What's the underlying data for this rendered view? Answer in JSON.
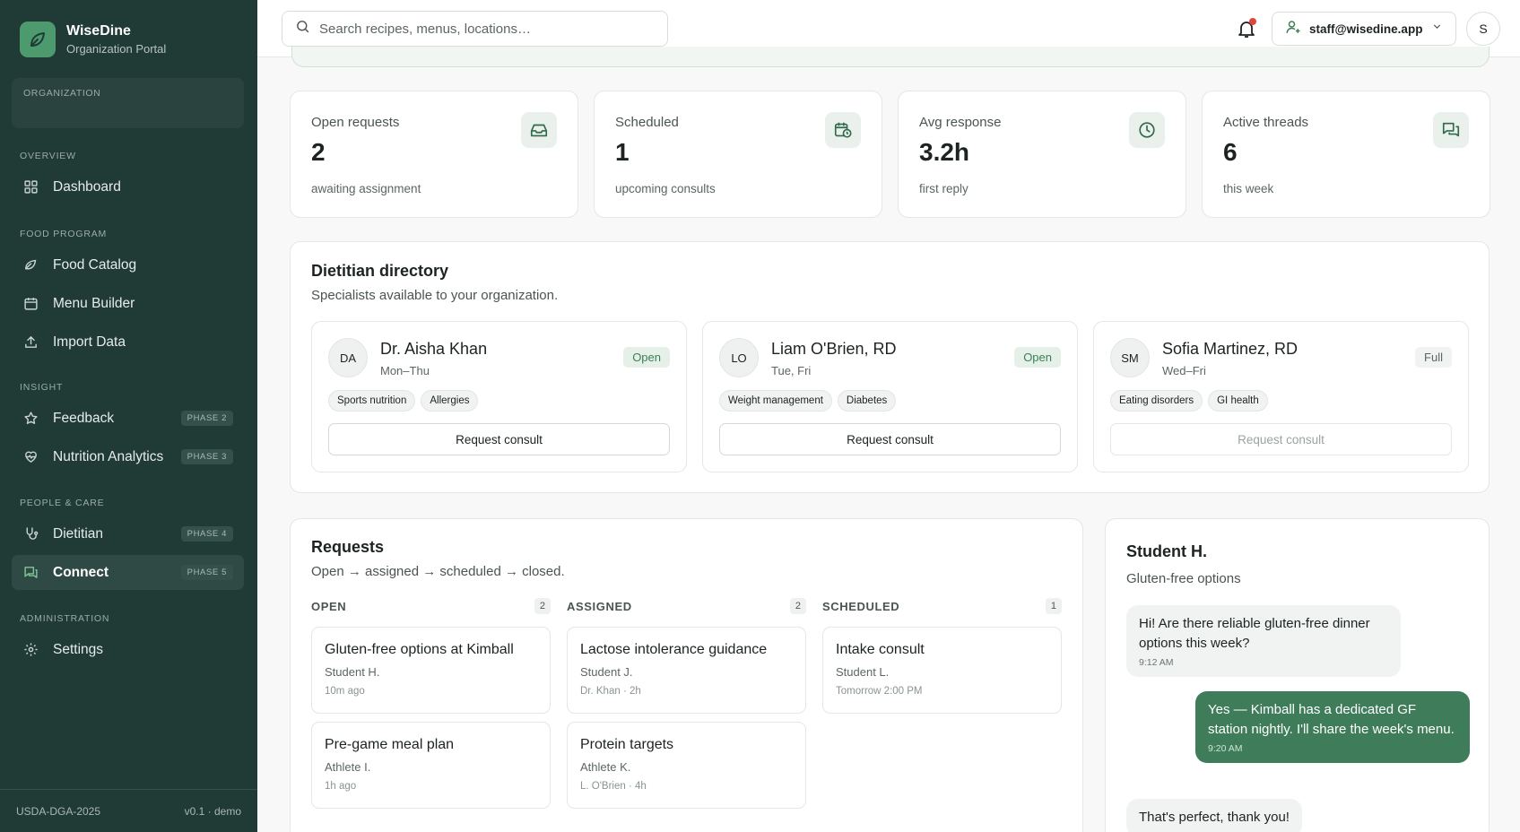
{
  "app": {
    "name": "WiseDine",
    "subtitle": "Organization Portal",
    "org_label": "ORGANIZATION"
  },
  "sidebar": {
    "sections": [
      {
        "label": "OVERVIEW"
      },
      {
        "label": "FOOD PROGRAM"
      },
      {
        "label": "INSIGHT"
      },
      {
        "label": "PEOPLE & CARE"
      },
      {
        "label": "ADMINISTRATION"
      }
    ],
    "items": [
      {
        "label": "Dashboard",
        "icon": "grid-icon"
      },
      {
        "label": "Food Catalog",
        "icon": "leaf-card-icon"
      },
      {
        "label": "Menu Builder",
        "icon": "calendar-icon"
      },
      {
        "label": "Import Data",
        "icon": "upload-icon"
      },
      {
        "label": "Feedback",
        "icon": "star-icon",
        "badge": "PHASE 2"
      },
      {
        "label": "Nutrition Analytics",
        "icon": "heart-pulse-icon",
        "badge": "PHASE 3"
      },
      {
        "label": "Dietitian",
        "icon": "stethoscope-icon",
        "badge": "PHASE 4"
      },
      {
        "label": "Connect",
        "icon": "chat-icon",
        "badge": "PHASE 5",
        "active": true
      },
      {
        "label": "Settings",
        "icon": "gear-icon"
      }
    ],
    "footer_left": "USDA-DGA-2025",
    "footer_right": "v0.1 · demo"
  },
  "topbar": {
    "search_placeholder": "Search recipes, menus, locations…",
    "user_email": "staff@wisedine.app",
    "avatar_initial": "S"
  },
  "stats": [
    {
      "title": "Open requests",
      "value": "2",
      "sub": "awaiting assignment",
      "icon": "inbox-icon"
    },
    {
      "title": "Scheduled",
      "value": "1",
      "sub": "upcoming consults",
      "icon": "calendar-clock-icon"
    },
    {
      "title": "Avg response",
      "value": "3.2h",
      "sub": "first reply",
      "icon": "clock-icon"
    },
    {
      "title": "Active threads",
      "value": "6",
      "sub": "this week",
      "icon": "messages-icon"
    }
  ],
  "directory": {
    "title": "Dietitian directory",
    "subtitle": "Specialists available to your organization.",
    "dietitians": [
      {
        "initials": "DA",
        "name": "Dr. Aisha Khan",
        "days": "Mon–Thu",
        "status": "Open",
        "tags": [
          "Sports nutrition",
          "Allergies"
        ],
        "button": "Request consult"
      },
      {
        "initials": "LO",
        "name": "Liam O'Brien, RD",
        "days": "Tue, Fri",
        "status": "Open",
        "tags": [
          "Weight management",
          "Diabetes"
        ],
        "button": "Request consult"
      },
      {
        "initials": "SM",
        "name": "Sofia Martinez, RD",
        "days": "Wed–Fri",
        "status": "Full",
        "tags": [
          "Eating disorders",
          "GI health"
        ],
        "button": "Request consult"
      }
    ]
  },
  "requests": {
    "title": "Requests",
    "subtitle": "Open → assigned → scheduled → closed.",
    "columns": [
      {
        "name": "OPEN",
        "count": "2",
        "cards": [
          {
            "title": "Gluten-free options at Kimball",
            "who": "Student H.",
            "meta": "10m ago"
          },
          {
            "title": "Pre-game meal plan",
            "who": "Athlete I.",
            "meta": "1h ago"
          }
        ]
      },
      {
        "name": "ASSIGNED",
        "count": "2",
        "cards": [
          {
            "title": "Lactose intolerance guidance",
            "who": "Student J.",
            "meta": "Dr. Khan · 2h"
          },
          {
            "title": "Protein targets",
            "who": "Athlete K.",
            "meta": "L. O'Brien · 4h"
          }
        ]
      },
      {
        "name": "SCHEDULED",
        "count": "1",
        "cards": [
          {
            "title": "Intake consult",
            "who": "Student L.",
            "meta": "Tomorrow 2:00 PM"
          }
        ]
      }
    ]
  },
  "chat": {
    "name": "Student H.",
    "topic": "Gluten-free options",
    "messages": [
      {
        "direction": "in",
        "text": "Hi! Are there reliable gluten-free dinner options this week?",
        "time": "9:12 AM"
      },
      {
        "direction": "out",
        "text": "Yes — Kimball has a dedicated GF station nightly. I'll share the week's menu.",
        "time": "9:20 AM"
      },
      {
        "direction": "in",
        "text": "That's perfect, thank you!",
        "time": ""
      }
    ]
  },
  "colors": {
    "sidebar": "#203a35",
    "accent": "#4d9a6e",
    "bubble_out": "#3f7d5a",
    "notification": "#e0463c"
  }
}
